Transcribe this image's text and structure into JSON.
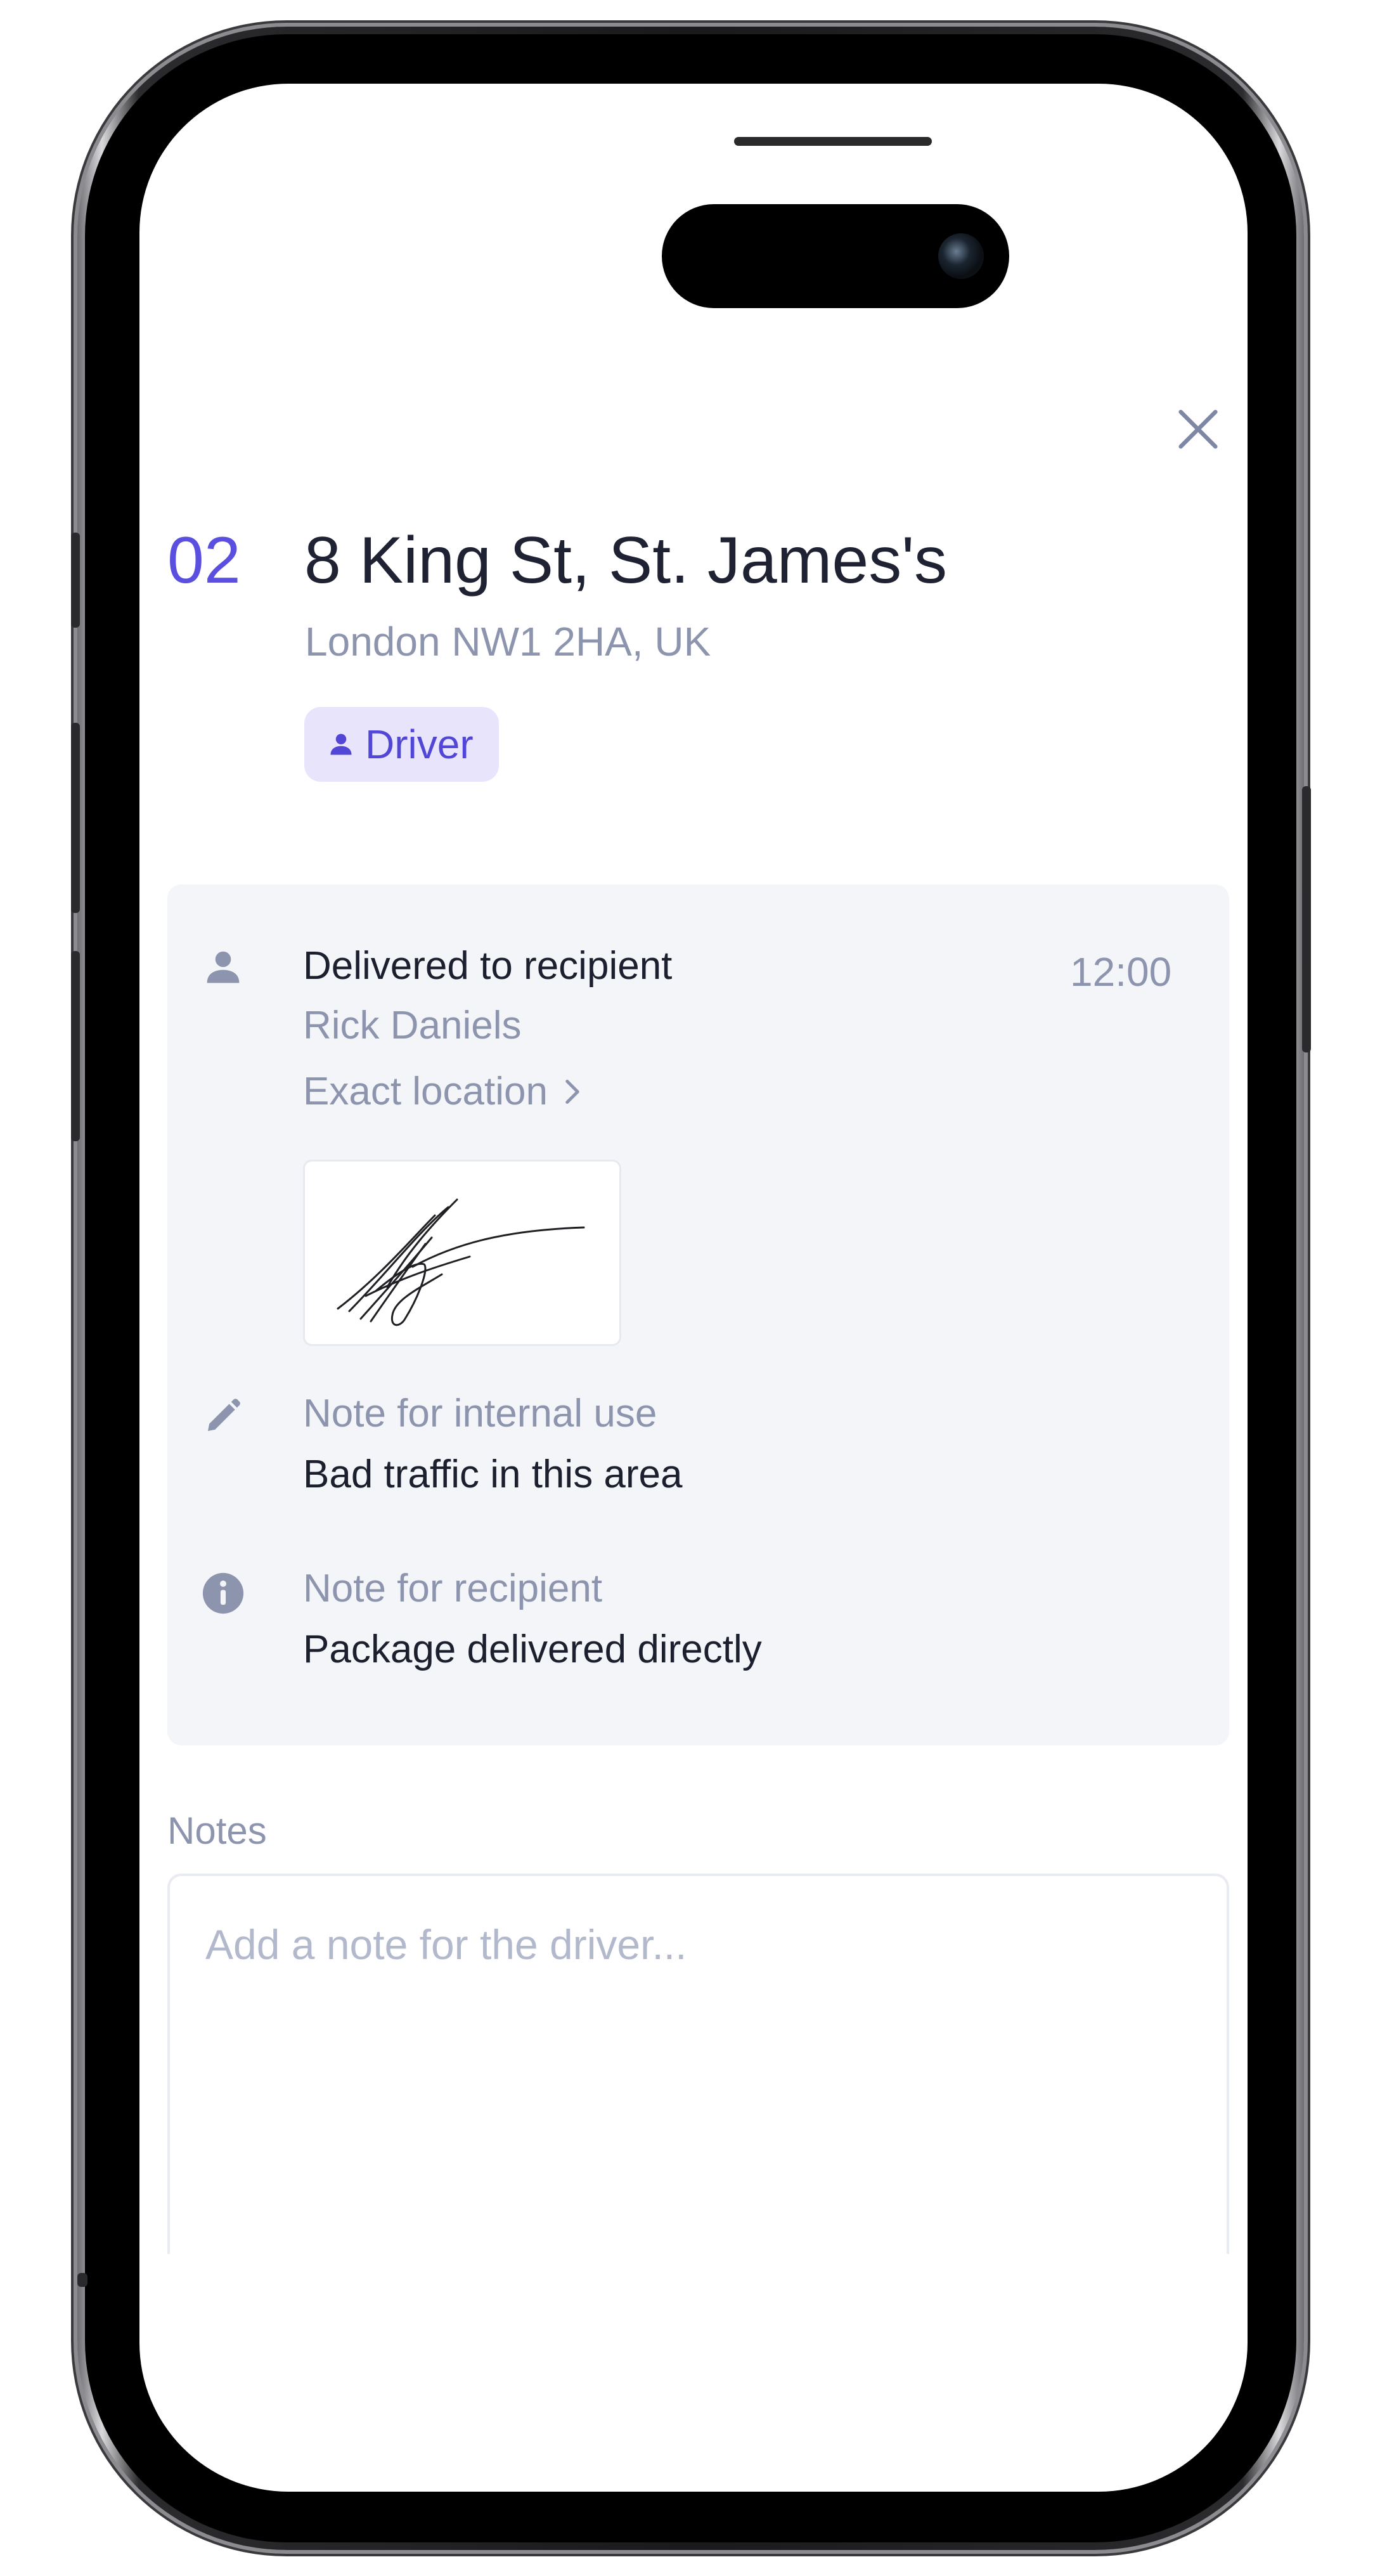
{
  "stop": {
    "number": "02",
    "address_line1": "8 King St, St. James's",
    "address_line2": "London NW1 2HA, UK",
    "badge_label": "Driver"
  },
  "delivery": {
    "status": "Delivered to recipient",
    "recipient_name": "Rick Daniels",
    "time": "12:00",
    "location_link": "Exact location",
    "internal_note_label": "Note for internal use",
    "internal_note_text": "Bad traffic in this area",
    "recipient_note_label": "Note for recipient",
    "recipient_note_text": "Package delivered directly"
  },
  "notes": {
    "label": "Notes",
    "placeholder": "Add a note for the driver..."
  },
  "icons": {
    "close": "close-icon",
    "badge": "person-icon",
    "recipient": "person-icon",
    "location_arrow": "chevron-right-icon",
    "internal_note": "pencil-icon",
    "recipient_note": "info-icon"
  },
  "colors": {
    "accent": "#5b4fe0",
    "badge_bg": "#e7e4fb",
    "card_bg": "#f3f5f9",
    "muted_text": "#8d94ad",
    "primary_text": "#1f2232"
  }
}
